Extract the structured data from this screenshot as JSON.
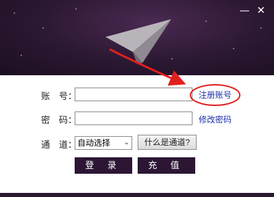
{
  "window": {
    "minimize_glyph": "—",
    "close_glyph": "✕"
  },
  "form": {
    "account_label": "账　号：",
    "password_label": "密　码：",
    "channel_label": "通　道：",
    "account_value": "",
    "password_value": "",
    "channel_selected": "自动选择",
    "register_link": "注册账号",
    "change_password_link": "修改密码",
    "what_channel_button": "什么是通道?",
    "login_button": "登 录",
    "recharge_button": "充 值"
  },
  "icons": {
    "plane": "paper-plane-icon",
    "dropdown": "chevron-down-icon"
  },
  "colors": {
    "header_bg": "#2a1730",
    "button_bg": "#2c1634",
    "link": "#1a2fa8",
    "annotation": "#e02020"
  }
}
